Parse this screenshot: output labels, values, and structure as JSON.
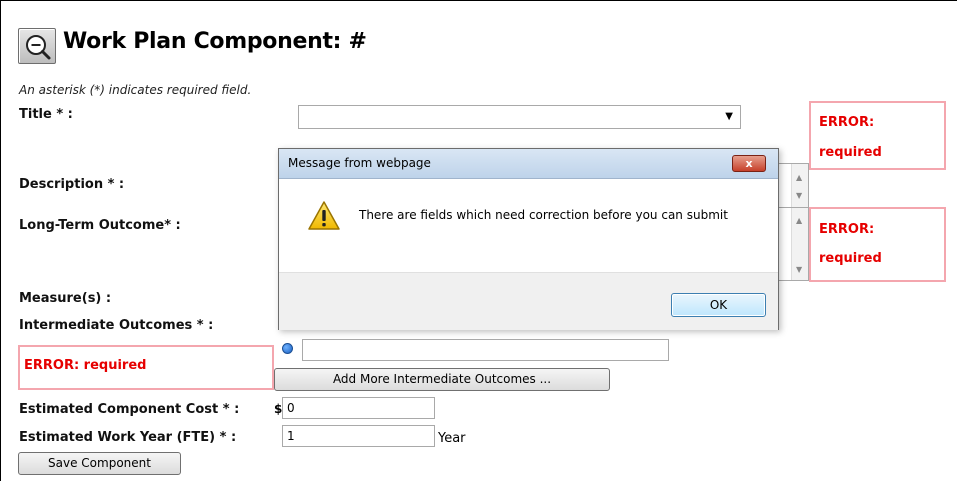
{
  "page": {
    "title_prefix": "Work Plan Component:",
    "title_hash": "#",
    "required_hint": "An asterisk (*) indicates required field."
  },
  "icons": {
    "zoom": "zoom-out-magnifier-icon",
    "dropdown": "dropdown-arrow-icon",
    "warning": "warning-triangle-icon",
    "close": "close-icon",
    "radio": "radio-bullet-icon"
  },
  "colors": {
    "error_text": "#e60000",
    "error_border": "#f4a6ae",
    "dialog_titlebar": "#c9dbef"
  },
  "fields": {
    "title": {
      "label": "Title * :",
      "value": ""
    },
    "description": {
      "label": "Description * :"
    },
    "long_term_outcome": {
      "label": "Long-Term Outcome* :"
    },
    "measures": {
      "label": "Measure(s) :"
    },
    "intermediate_outcomes": {
      "label": "Intermediate Outcomes * :",
      "value": ""
    },
    "estimated_cost": {
      "label": "Estimated Component Cost * :",
      "currency": "$",
      "value": "0"
    },
    "estimated_work_year": {
      "label": "Estimated Work Year (FTE) * :",
      "value": "1",
      "unit": "Year"
    }
  },
  "errors": {
    "title_line1": "ERROR:",
    "title_line2": "required",
    "outcome_line1": "ERROR:",
    "outcome_line2": "required",
    "intermediate": "ERROR: required"
  },
  "buttons": {
    "add_more": "Add More Intermediate Outcomes ...",
    "save": "Save Component"
  },
  "dialog": {
    "title": "Message from webpage",
    "close_label": "x",
    "message": "There are fields which need correction before you can submit",
    "ok_label": "OK"
  }
}
